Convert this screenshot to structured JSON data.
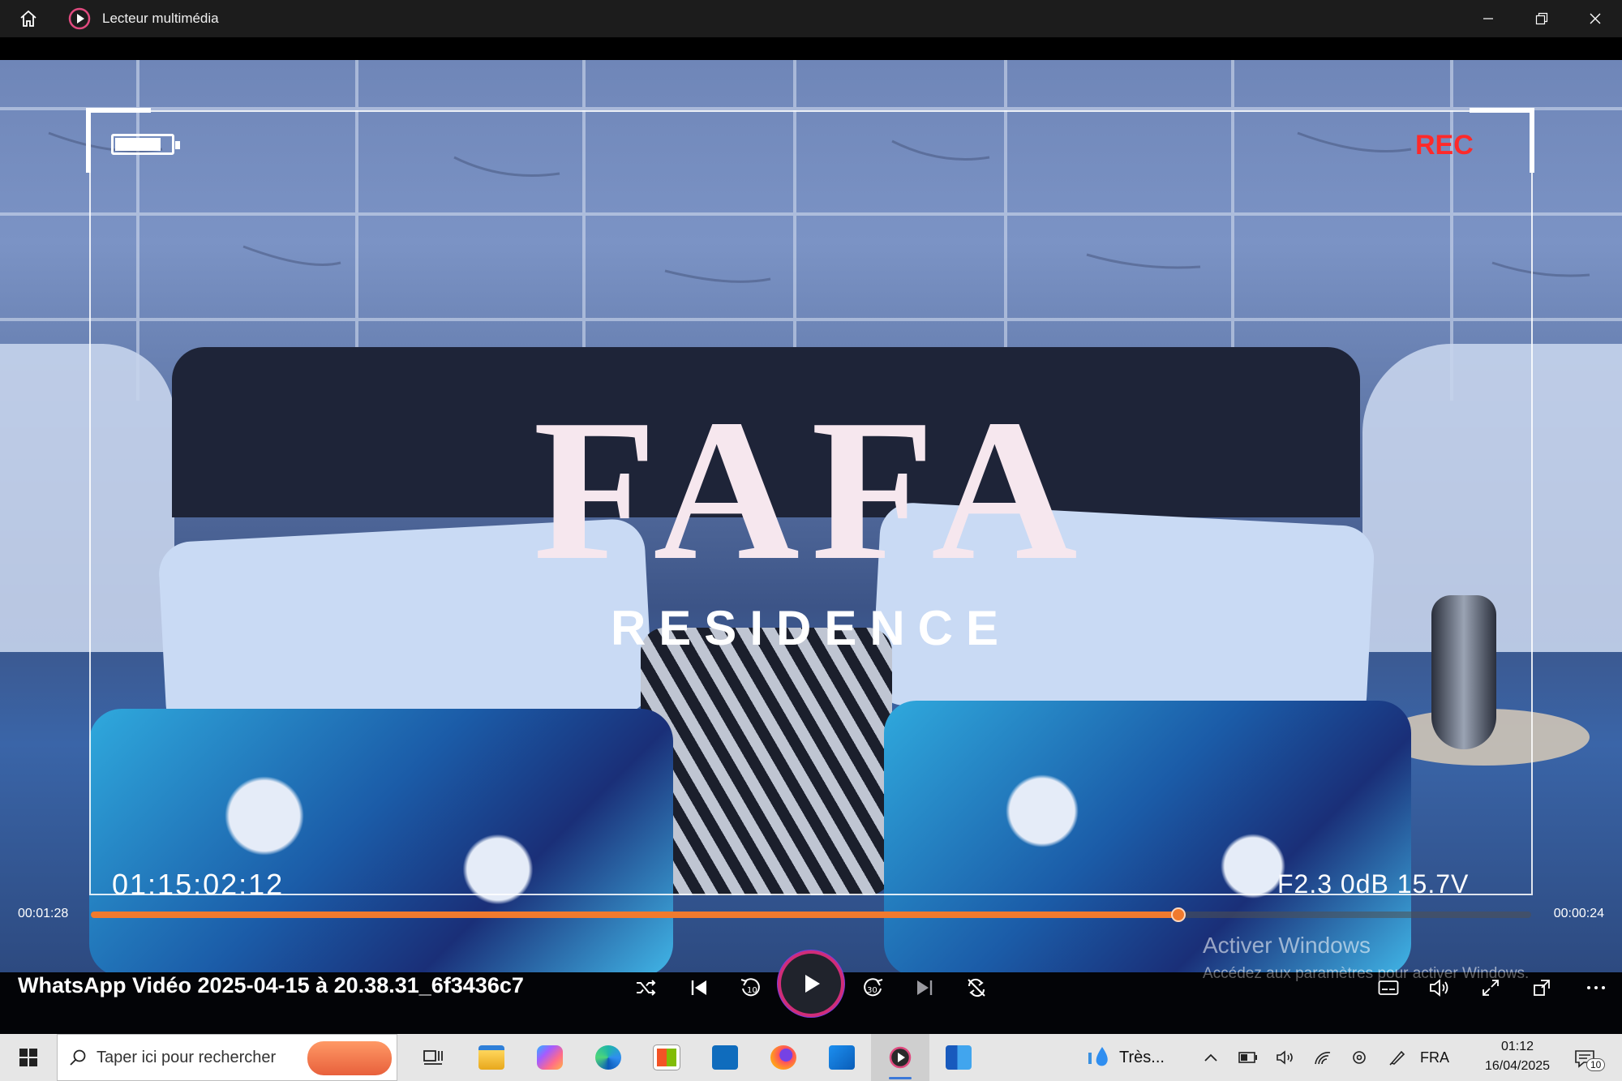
{
  "app": {
    "title": "Lecteur multimédia"
  },
  "video_overlay": {
    "rec": "REC",
    "timecode": "01:15:02:12",
    "camera_stats": "F2.3  0dB 15.7V",
    "brand_title": "FAFA",
    "brand_subtitle": "RESIDENCE"
  },
  "player": {
    "elapsed": "00:01:28",
    "remaining": "00:00:24",
    "progress_fraction": 0.755,
    "filename": "WhatsApp Vidéo 2025-04-15 à 20.38.31_6f3436c7",
    "skip_back_label": "10",
    "skip_forward_label": "30",
    "accent_color": "#f07a2e"
  },
  "watermark": {
    "title": "Activer Windows",
    "subtitle": "Accédez aux paramètres pour activer Windows."
  },
  "taskbar": {
    "search_placeholder": "Taper ici pour rechercher",
    "weather": "Très...",
    "language": "FRA",
    "time": "01:12",
    "date": "16/04/2025",
    "notifications": "10"
  }
}
